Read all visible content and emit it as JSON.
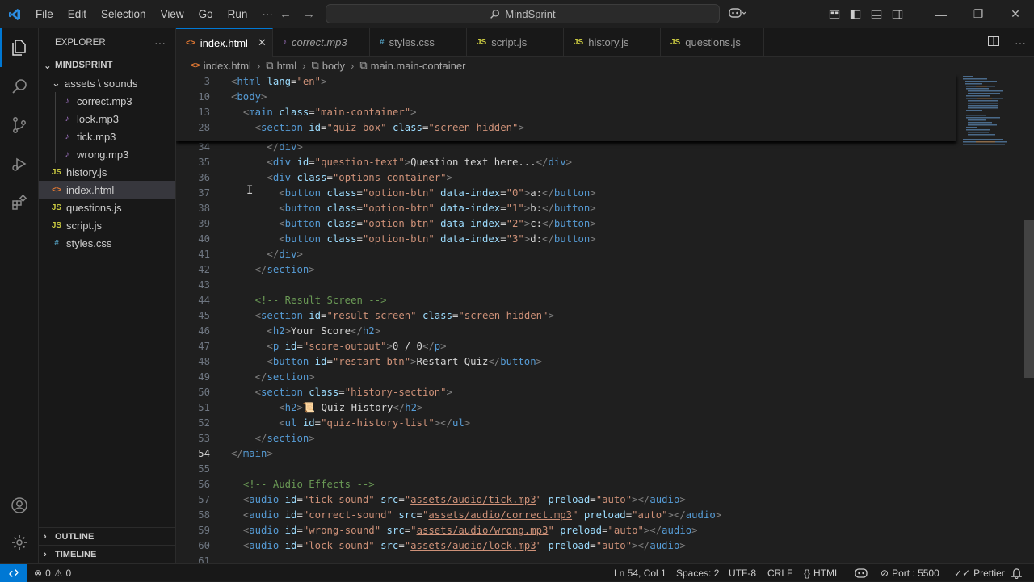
{
  "titlebar": {
    "menu": [
      "File",
      "Edit",
      "Selection",
      "View",
      "Go",
      "Run",
      "···"
    ],
    "search": "MindSprint"
  },
  "explorer": {
    "title": "EXPLORER",
    "root": "MINDSPRINT",
    "folder": "assets \\ sounds",
    "folder_files": [
      "correct.mp3",
      "lock.mp3",
      "tick.mp3",
      "wrong.mp3"
    ],
    "files": [
      {
        "name": "history.js",
        "type": "js",
        "icon": "JS"
      },
      {
        "name": "index.html",
        "type": "html",
        "icon": "<>"
      },
      {
        "name": "questions.js",
        "type": "js",
        "icon": "JS"
      },
      {
        "name": "script.js",
        "type": "js",
        "icon": "JS"
      },
      {
        "name": "styles.css",
        "type": "css",
        "icon": "#"
      }
    ],
    "outline": "OUTLINE",
    "timeline": "TIMELINE"
  },
  "tabs": [
    {
      "label": "index.html",
      "icon": "<>",
      "kind": "html",
      "active": true
    },
    {
      "label": "correct.mp3",
      "icon": "♪",
      "kind": "mp3",
      "active": false
    },
    {
      "label": "styles.css",
      "icon": "#",
      "kind": "css",
      "active": false
    },
    {
      "label": "script.js",
      "icon": "JS",
      "kind": "js",
      "active": false
    },
    {
      "label": "history.js",
      "icon": "JS",
      "kind": "js",
      "active": false
    },
    {
      "label": "questions.js",
      "icon": "JS",
      "kind": "js",
      "active": false
    }
  ],
  "breadcrumb": [
    "index.html",
    "html",
    "body",
    "main.main-container"
  ],
  "sticky_lines": [
    {
      "n": "3",
      "html": "<span class='br'>&lt;</span><span class='tg'>html</span> <span class='at'>lang</span>=<span class='st'>\"en\"</span><span class='br'>&gt;</span>"
    },
    {
      "n": "10",
      "html": "<span class='br'>&lt;</span><span class='tg'>body</span><span class='br'>&gt;</span>"
    },
    {
      "n": "13",
      "html": "  <span class='br'>&lt;</span><span class='tg'>main</span> <span class='at'>class</span>=<span class='st'>\"main-container\"</span><span class='br'>&gt;</span>"
    },
    {
      "n": "28",
      "html": "    <span class='br'>&lt;</span><span class='tg'>section</span> <span class='at'>id</span>=<span class='st'>\"quiz-box\"</span> <span class='at'>class</span>=<span class='st'>\"screen hidden\"</span><span class='br'>&gt;</span>"
    }
  ],
  "lines": [
    {
      "n": "34",
      "html": "      <span class='br'>&lt;/</span><span class='tg'>div</span><span class='br'>&gt;</span>"
    },
    {
      "n": "35",
      "html": "      <span class='br'>&lt;</span><span class='tg'>div</span> <span class='at'>id</span>=<span class='st'>\"question-text\"</span><span class='br'>&gt;</span><span class='tx'>Question text here...</span><span class='br'>&lt;/</span><span class='tg'>div</span><span class='br'>&gt;</span>"
    },
    {
      "n": "36",
      "html": "      <span class='br'>&lt;</span><span class='tg'>div</span> <span class='at'>class</span>=<span class='st'>\"options-container\"</span><span class='br'>&gt;</span>"
    },
    {
      "n": "37",
      "html": "        <span class='br'>&lt;</span><span class='tg'>button</span> <span class='at'>class</span>=<span class='st'>\"option-btn\"</span> <span class='at'>data-index</span>=<span class='st'>\"0\"</span><span class='br'>&gt;</span><span class='tx'>a:</span><span class='br'>&lt;/</span><span class='tg'>button</span><span class='br'>&gt;</span>"
    },
    {
      "n": "38",
      "html": "        <span class='br'>&lt;</span><span class='tg'>button</span> <span class='at'>class</span>=<span class='st'>\"option-btn\"</span> <span class='at'>data-index</span>=<span class='st'>\"1\"</span><span class='br'>&gt;</span><span class='tx'>b:</span><span class='br'>&lt;/</span><span class='tg'>button</span><span class='br'>&gt;</span>"
    },
    {
      "n": "39",
      "html": "        <span class='br'>&lt;</span><span class='tg'>button</span> <span class='at'>class</span>=<span class='st'>\"option-btn\"</span> <span class='at'>data-index</span>=<span class='st'>\"2\"</span><span class='br'>&gt;</span><span class='tx'>c:</span><span class='br'>&lt;/</span><span class='tg'>button</span><span class='br'>&gt;</span>"
    },
    {
      "n": "40",
      "html": "        <span class='br'>&lt;</span><span class='tg'>button</span> <span class='at'>class</span>=<span class='st'>\"option-btn\"</span> <span class='at'>data-index</span>=<span class='st'>\"3\"</span><span class='br'>&gt;</span><span class='tx'>d:</span><span class='br'>&lt;/</span><span class='tg'>button</span><span class='br'>&gt;</span>"
    },
    {
      "n": "41",
      "html": "      <span class='br'>&lt;/</span><span class='tg'>div</span><span class='br'>&gt;</span>"
    },
    {
      "n": "42",
      "html": "    <span class='br'>&lt;/</span><span class='tg'>section</span><span class='br'>&gt;</span>"
    },
    {
      "n": "43",
      "html": ""
    },
    {
      "n": "44",
      "html": "    <span class='cm'>&lt;!-- Result Screen --&gt;</span>"
    },
    {
      "n": "45",
      "html": "    <span class='br'>&lt;</span><span class='tg'>section</span> <span class='at'>id</span>=<span class='st'>\"result-screen\"</span> <span class='at'>class</span>=<span class='st'>\"screen hidden\"</span><span class='br'>&gt;</span>"
    },
    {
      "n": "46",
      "html": "      <span class='br'>&lt;</span><span class='tg'>h2</span><span class='br'>&gt;</span><span class='tx'>Your Score</span><span class='br'>&lt;/</span><span class='tg'>h2</span><span class='br'>&gt;</span>"
    },
    {
      "n": "47",
      "html": "      <span class='br'>&lt;</span><span class='tg'>p</span> <span class='at'>id</span>=<span class='st'>\"score-output\"</span><span class='br'>&gt;</span><span class='tx'>0 / 0</span><span class='br'>&lt;/</span><span class='tg'>p</span><span class='br'>&gt;</span>"
    },
    {
      "n": "48",
      "html": "      <span class='br'>&lt;</span><span class='tg'>button</span> <span class='at'>id</span>=<span class='st'>\"restart-btn\"</span><span class='br'>&gt;</span><span class='tx'>Restart Quiz</span><span class='br'>&lt;/</span><span class='tg'>button</span><span class='br'>&gt;</span>"
    },
    {
      "n": "49",
      "html": "    <span class='br'>&lt;/</span><span class='tg'>section</span><span class='br'>&gt;</span>"
    },
    {
      "n": "50",
      "html": "    <span class='br'>&lt;</span><span class='tg'>section</span> <span class='at'>class</span>=<span class='st'>\"history-section\"</span><span class='br'>&gt;</span>"
    },
    {
      "n": "51",
      "html": "        <span class='br'>&lt;</span><span class='tg'>h2</span><span class='br'>&gt;</span><span class='tx'>📜 Quiz History</span><span class='br'>&lt;/</span><span class='tg'>h2</span><span class='br'>&gt;</span>"
    },
    {
      "n": "52",
      "html": "        <span class='br'>&lt;</span><span class='tg'>ul</span> <span class='at'>id</span>=<span class='st'>\"quiz-history-list\"</span><span class='br'>&gt;&lt;/</span><span class='tg'>ul</span><span class='br'>&gt;</span>"
    },
    {
      "n": "53",
      "html": "    <span class='br'>&lt;/</span><span class='tg'>section</span><span class='br'>&gt;</span>"
    },
    {
      "n": "54",
      "html": "<span class='br'>&lt;/</span><span class='tg'>main</span><span class='br'>&gt;</span>",
      "current": true
    },
    {
      "n": "55",
      "html": ""
    },
    {
      "n": "56",
      "html": "  <span class='cm'>&lt;!-- Audio Effects --&gt;</span>"
    },
    {
      "n": "57",
      "html": "  <span class='br'>&lt;</span><span class='tg'>audio</span> <span class='at'>id</span>=<span class='st'>\"tick-sound\"</span> <span class='at'>src</span>=<span class='st'>\"<span class='ul'>assets/audio/tick.mp3</span>\"</span> <span class='at'>preload</span>=<span class='st'>\"auto\"</span><span class='br'>&gt;&lt;/</span><span class='tg'>audio</span><span class='br'>&gt;</span>"
    },
    {
      "n": "58",
      "html": "  <span class='br'>&lt;</span><span class='tg'>audio</span> <span class='at'>id</span>=<span class='st'>\"correct-sound\"</span> <span class='at'>src</span>=<span class='st'>\"<span class='ul'>assets/audio/correct.mp3</span>\"</span> <span class='at'>preload</span>=<span class='st'>\"auto\"</span><span class='br'>&gt;&lt;/</span><span class='tg'>audio</span><span class='br'>&gt;</span>"
    },
    {
      "n": "59",
      "html": "  <span class='br'>&lt;</span><span class='tg'>audio</span> <span class='at'>id</span>=<span class='st'>\"wrong-sound\"</span> <span class='at'>src</span>=<span class='st'>\"<span class='ul'>assets/audio/wrong.mp3</span>\"</span> <span class='at'>preload</span>=<span class='st'>\"auto\"</span><span class='br'>&gt;&lt;/</span><span class='tg'>audio</span><span class='br'>&gt;</span>"
    },
    {
      "n": "60",
      "html": "  <span class='br'>&lt;</span><span class='tg'>audio</span> <span class='at'>id</span>=<span class='st'>\"lock-sound\"</span> <span class='at'>src</span>=<span class='st'>\"<span class='ul'>assets/audio/lock.mp3</span>\"</span> <span class='at'>preload</span>=<span class='st'>\"auto\"</span><span class='br'>&gt;&lt;/</span><span class='tg'>audio</span><span class='br'>&gt;</span>"
    },
    {
      "n": "61",
      "html": ""
    }
  ],
  "statusbar": {
    "errors": "0",
    "warnings": "0",
    "position": "Ln 54, Col 1",
    "spaces": "Spaces: 2",
    "encoding": "UTF-8",
    "eol": "CRLF",
    "language": "HTML",
    "port": "Port : 5500",
    "formatter": "Prettier"
  },
  "colors": {
    "accent": "#0078d4",
    "statusbar_remote": "#0078d4"
  }
}
